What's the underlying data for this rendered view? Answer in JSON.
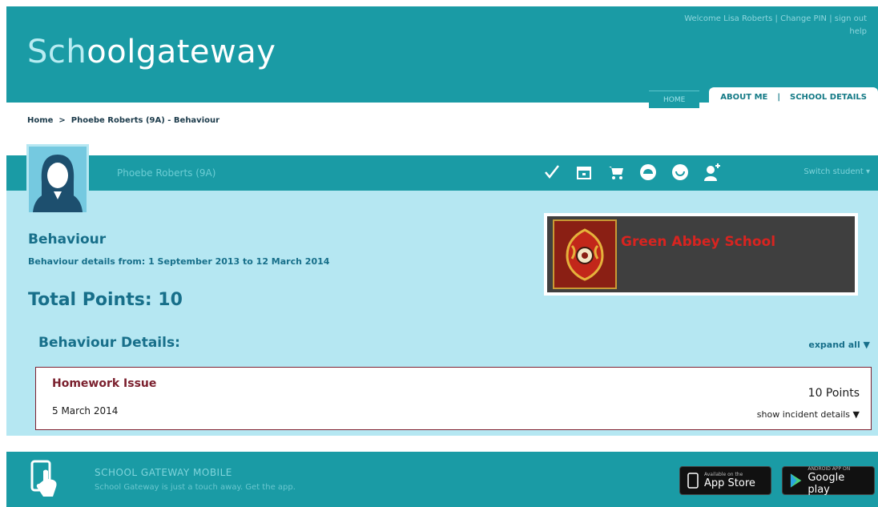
{
  "header": {
    "logo_part1": "Sch",
    "logo_part2": "o",
    "logo_part3": "o",
    "logo_part4": "lgateway",
    "welcome": "Welcome Lisa Roberts",
    "change_pin": "Change PIN",
    "sign_out": "sign out",
    "help": "help"
  },
  "tabs": {
    "home": "HOME",
    "about_me": "ABOUT ME",
    "separator": "|",
    "school_details": "SCHOOL DETAILS"
  },
  "breadcrumb": {
    "home": "Home",
    "arrow": ">",
    "current": "Phoebe Roberts (9A) - Behaviour"
  },
  "student": {
    "name": "Phoebe Roberts (9A)",
    "switcher": "Switch student ▾",
    "icons": [
      "check-icon",
      "calendar-icon",
      "cart-icon",
      "meal-icon",
      "happy-icon",
      "person-add-icon"
    ]
  },
  "behaviour": {
    "title": "Behaviour",
    "range": "Behaviour details from: 1 September 2013 to 12 March 2014",
    "total": "Total Points: 10",
    "details_heading": "Behaviour Details:",
    "expand_all": "expand all ▼"
  },
  "school": {
    "name": "Green Abbey School"
  },
  "incidents": [
    {
      "title": "Homework Issue",
      "date": "5 March 2014",
      "points": "10 Points",
      "toggle": "show incident details ▼"
    }
  ],
  "footer": {
    "title": "SCHOOL GATEWAY MOBILE",
    "subtitle": "School Gateway is just a touch away. Get the app.",
    "appstore_small": "Available on the",
    "appstore_big": "App Store",
    "google_small": "ANDROID APP ON",
    "google_big": "Google play"
  },
  "colors": {
    "teal": "#1a9ba5",
    "light_blue": "#b5e7f2",
    "maroon": "#7a1f2d"
  }
}
